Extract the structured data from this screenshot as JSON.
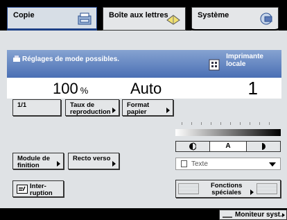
{
  "tabs": {
    "copy": "Copie",
    "mailbox": "Boîte aux lettres",
    "system": "Système"
  },
  "status": {
    "message": "Réglages de mode possibles.",
    "location_line1": "Imprimante",
    "location_line2": "locale"
  },
  "values": {
    "ratio": "100",
    "ratio_unit": "%",
    "paper": "Auto",
    "quantity": "1"
  },
  "buttons": {
    "one_to_one": "1/1",
    "ratio_line1": "Taux de",
    "ratio_line2": "reproduction",
    "paper_line1": "Format",
    "paper_line2": "papier",
    "finish_line1": "Module de",
    "finish_line2": "finition",
    "duplex": "Recto verso",
    "interrupt_line1": "Inter-",
    "interrupt_line2": "ruption",
    "special_line1": "Fonctions",
    "special_line2": "spéciales"
  },
  "density": {
    "auto_label": "A"
  },
  "image_type": {
    "selected": "Texte"
  },
  "footer": {
    "monitor": "Moniteur syst."
  },
  "icons": {
    "copy": "copier-icon",
    "mailbox": "mailbox-icon",
    "system": "globe-icon",
    "message": "copier-small-icon",
    "location": "printer-building-icon",
    "interrupt": "interrupt-icon",
    "monitor": "monitor-icon"
  },
  "colors": {
    "accent": "#1c3f86",
    "band_top": "#86a3d1",
    "band_bottom": "#4a6fb4"
  }
}
